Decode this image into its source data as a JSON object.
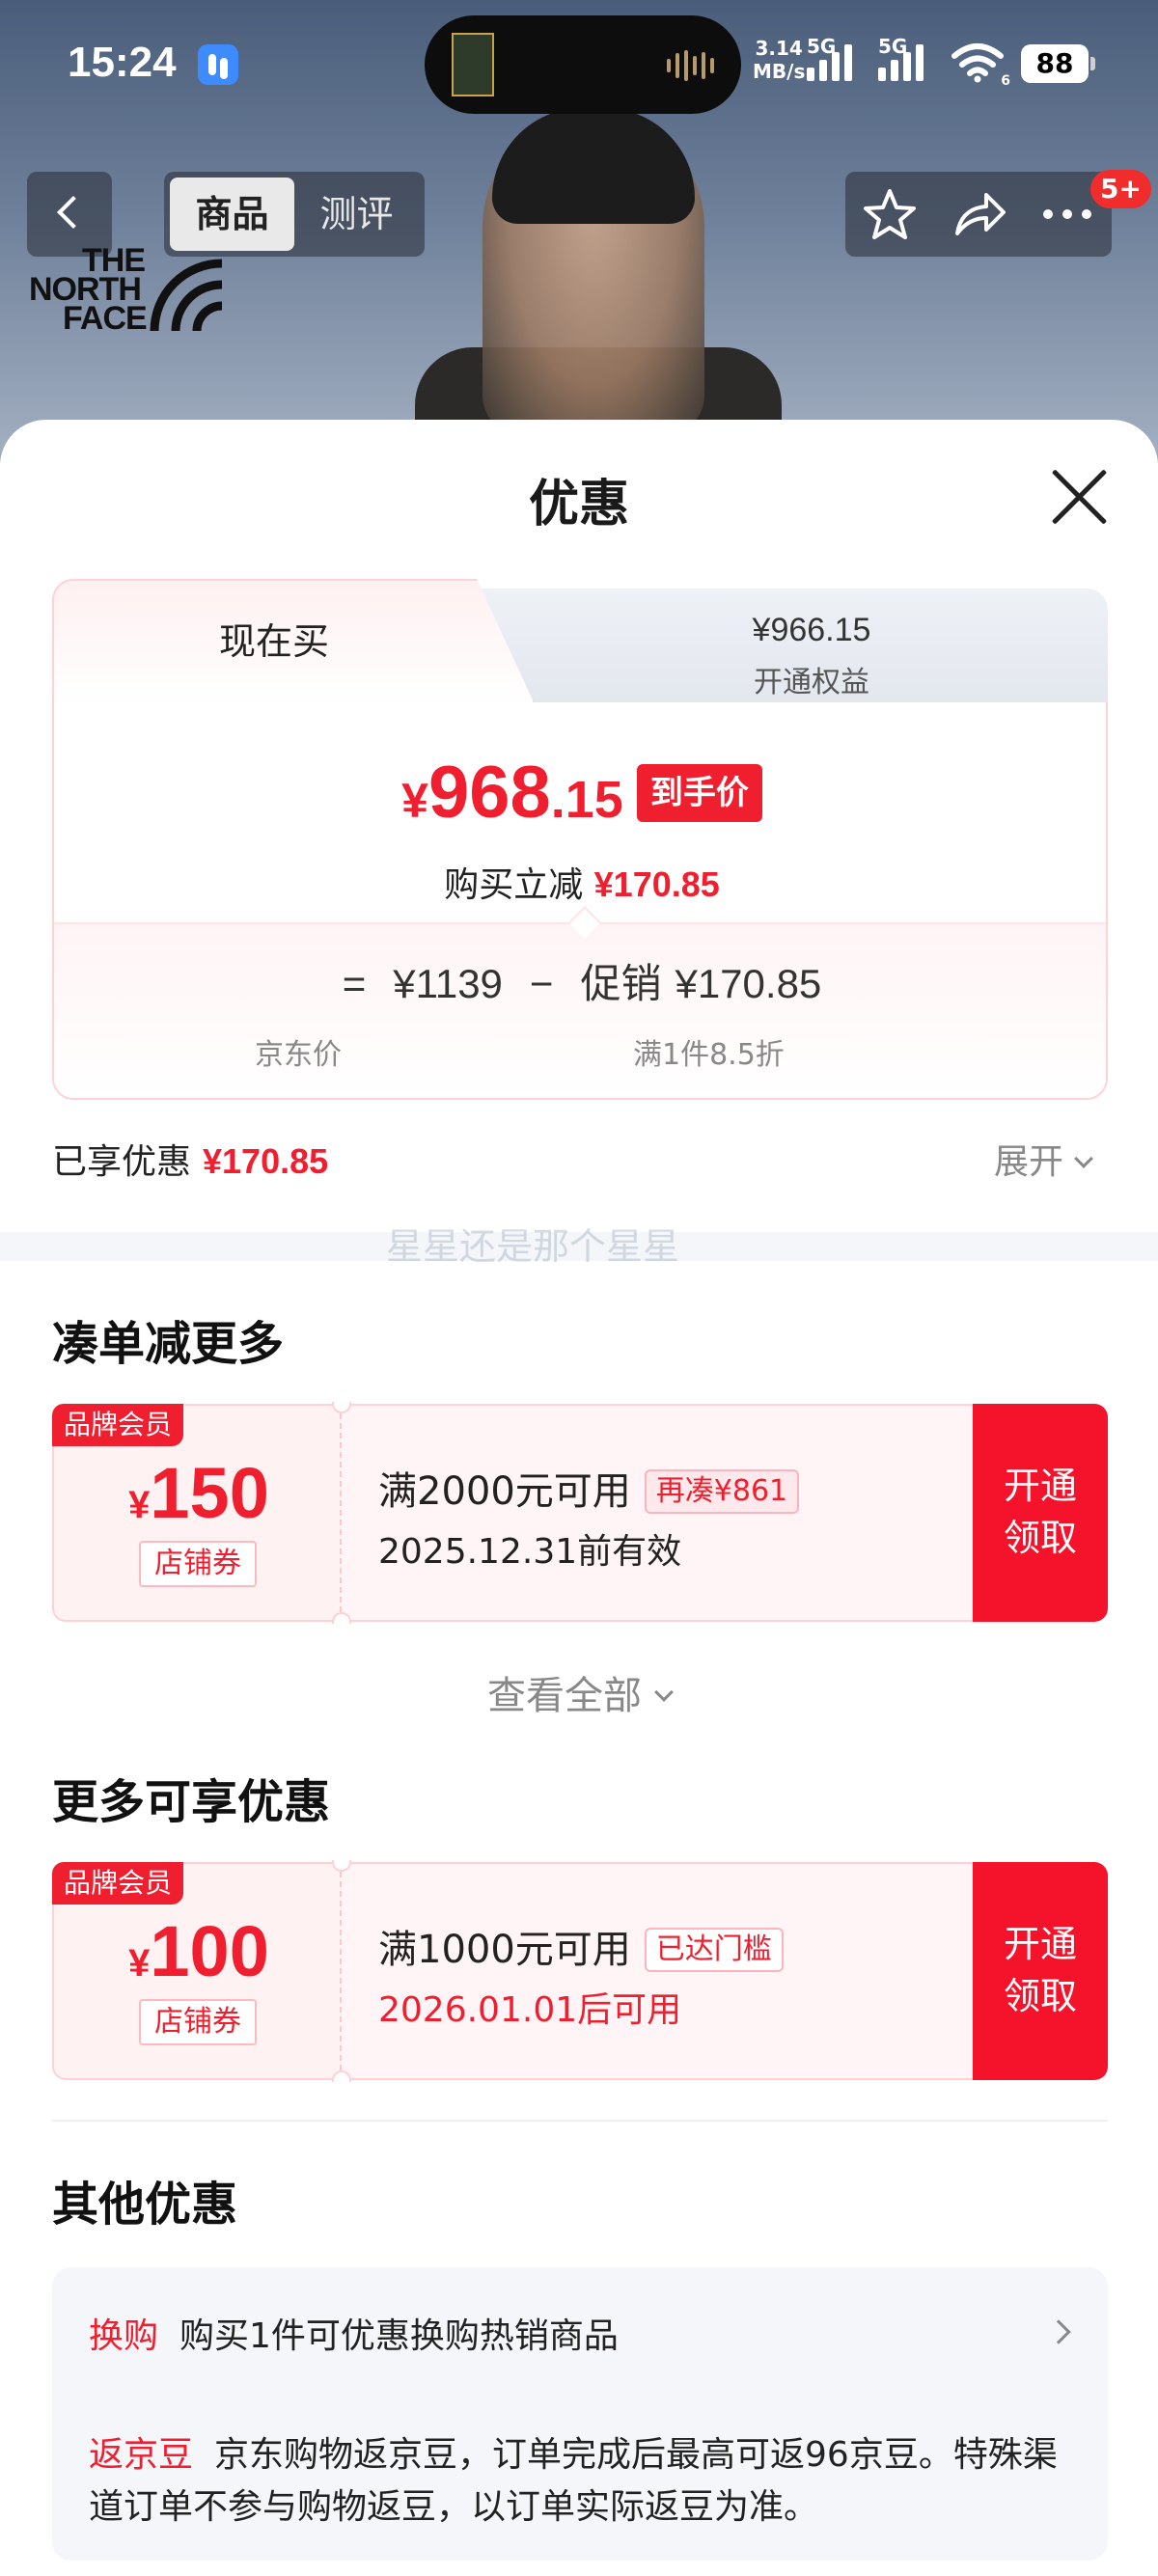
{
  "status_bar": {
    "time": "15:24",
    "net_speed_value": "3.14",
    "net_speed_unit": "MB/s",
    "signal1_label": "5G",
    "signal2_label": "5G",
    "wifi_label": "6",
    "battery": "88"
  },
  "nav": {
    "tabs": [
      {
        "label": "商品",
        "active": true
      },
      {
        "label": "测评",
        "active": false
      }
    ],
    "brand_logo_text": [
      "THE",
      "NORTH",
      "FACE"
    ],
    "message_badge": "5+",
    "icons": [
      "back-icon",
      "star-icon",
      "share-icon",
      "more-icon"
    ]
  },
  "sheet": {
    "title": "优惠",
    "price_tabs": {
      "buy_now_label": "现在买",
      "member_price": "¥966.15",
      "member_label": "开通权益"
    },
    "final_price": {
      "yen": "¥",
      "integer": "968",
      "decimal": ".15",
      "tag": "到手价"
    },
    "reduce": {
      "label": "购买立减",
      "amount": "¥170.85"
    },
    "calc": {
      "equals": "=",
      "jd_price": "¥1139",
      "minus": "−",
      "promo_label": "促销",
      "promo_amount": "¥170.85",
      "jd_price_label": "京东价",
      "promo_desc": "满1件8.5折"
    },
    "enjoyed": {
      "label": "已享优惠",
      "amount": "¥170.85",
      "expand_label": "展开"
    },
    "watermark": "星星还是那个星星",
    "section_more": "凑单减更多",
    "coupon1": {
      "badge": "品牌会员",
      "yen": "¥",
      "amount": "150",
      "type": "店铺券",
      "condition": "满2000元可用",
      "chip": "再凑¥861",
      "date": "2025.12.31前有效",
      "button_line1": "开通",
      "button_line2": "领取"
    },
    "view_all": "查看全部",
    "section_available": "更多可享优惠",
    "coupon2": {
      "badge": "品牌会员",
      "yen": "¥",
      "amount": "100",
      "type": "店铺券",
      "condition": "满1000元可用",
      "chip": "已达门槛",
      "date": "2026.01.01后可用",
      "button_line1": "开通",
      "button_line2": "领取"
    },
    "section_other": "其他优惠",
    "other": {
      "exchange_tag": "换购",
      "exchange_text": "购买1件可优惠换购热销商品",
      "bean_tag": "返京豆",
      "bean_text": "京东购物返京豆，订单完成后最高可返96京豆。特殊渠道订单不参与购物返豆，以订单实际返豆为准。"
    }
  },
  "colors": {
    "accent_red": "#f01f2f",
    "coupon_button_red": "#f5132b",
    "battery_bg": "#ffffff"
  }
}
